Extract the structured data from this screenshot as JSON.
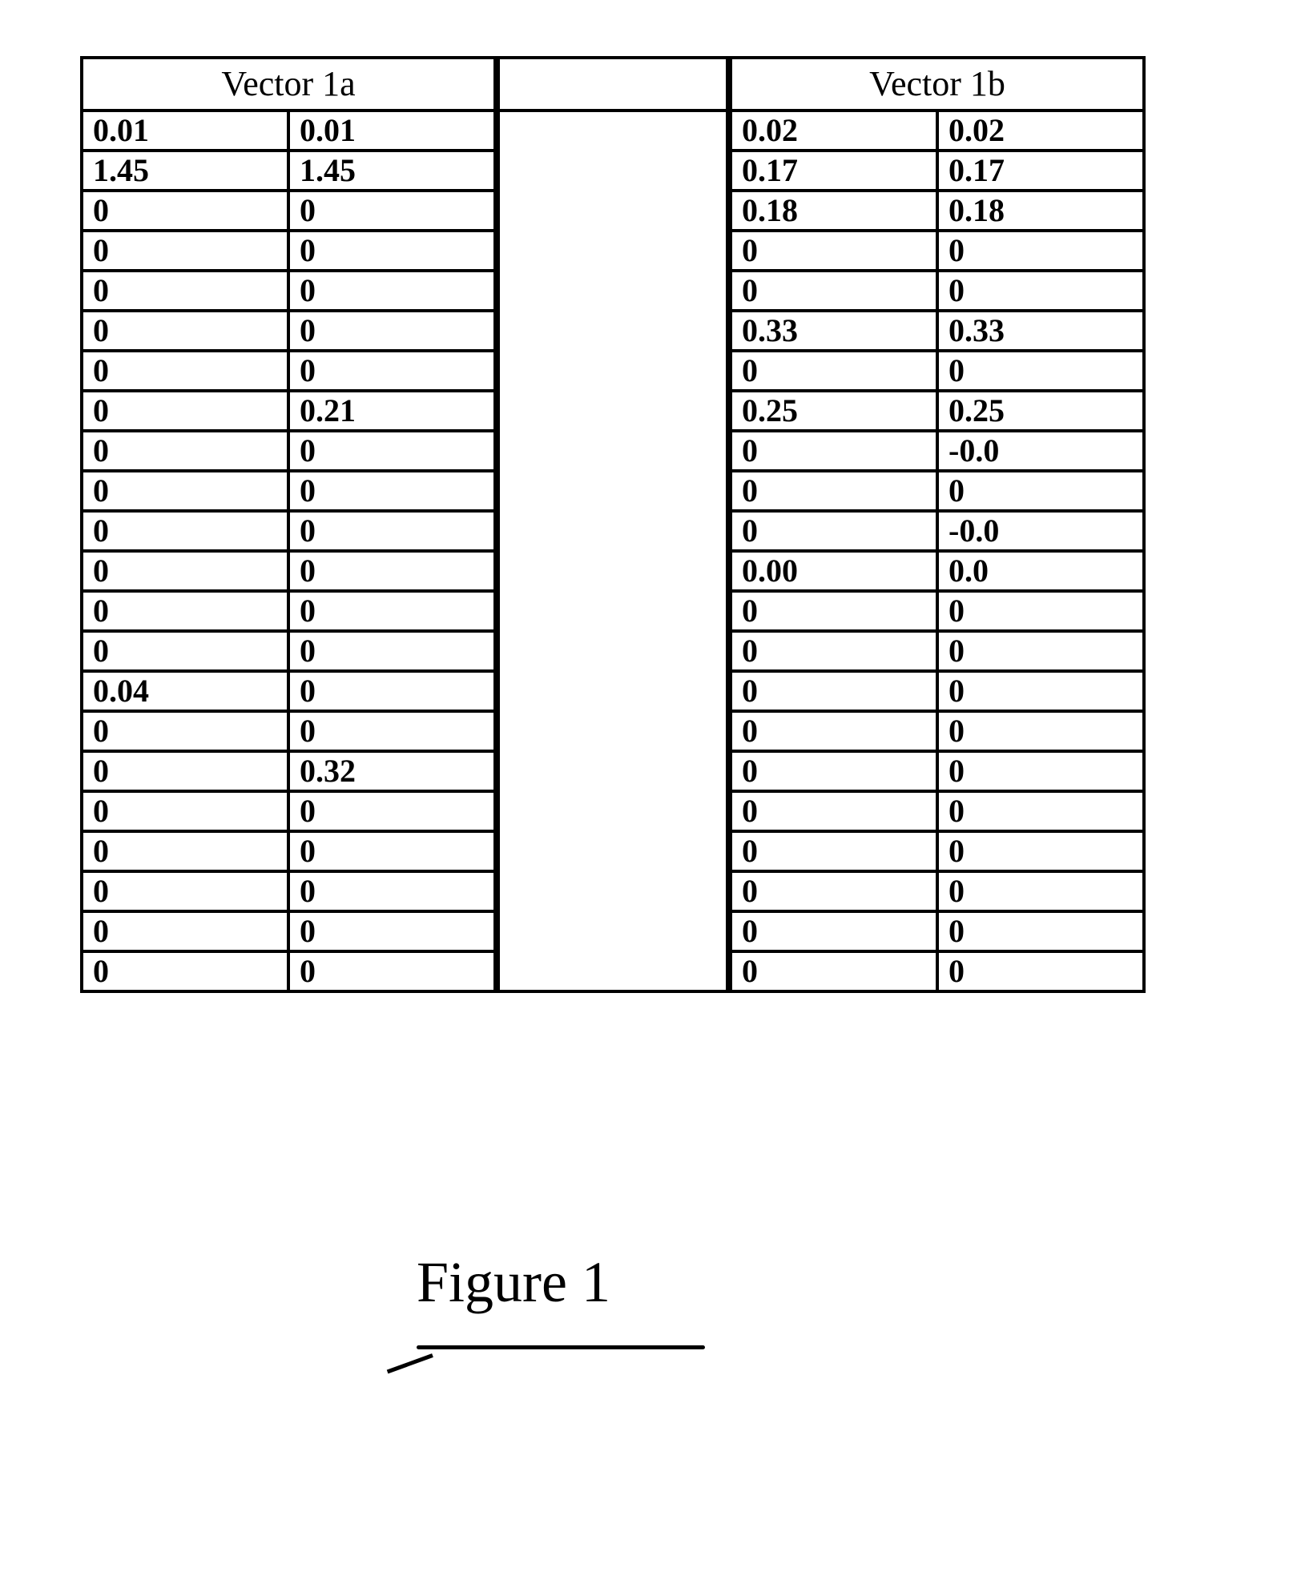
{
  "vector_a": {
    "title": "Vector 1a",
    "rows": [
      [
        "0.01",
        "0.01"
      ],
      [
        "1.45",
        "1.45"
      ],
      [
        "0",
        "0"
      ],
      [
        "0",
        "0"
      ],
      [
        "0",
        "0"
      ],
      [
        "0",
        "0"
      ],
      [
        "0",
        "0"
      ],
      [
        "0",
        "0.21"
      ],
      [
        "0",
        "0"
      ],
      [
        "0",
        "0"
      ],
      [
        "0",
        "0"
      ],
      [
        "0",
        "0"
      ],
      [
        "0",
        "0"
      ],
      [
        "0",
        "0"
      ],
      [
        "0.04",
        "0"
      ],
      [
        "0",
        "0"
      ],
      [
        "0",
        "0.32"
      ],
      [
        "0",
        "0"
      ],
      [
        "0",
        "0"
      ],
      [
        "0",
        "0"
      ],
      [
        "0",
        "0"
      ],
      [
        "0",
        "0"
      ]
    ]
  },
  "vector_b": {
    "title": "Vector 1b",
    "rows": [
      [
        "0.02",
        "0.02"
      ],
      [
        "0.17",
        "0.17"
      ],
      [
        "0.18",
        "0.18"
      ],
      [
        "0",
        "0"
      ],
      [
        "0",
        "0"
      ],
      [
        "0.33",
        "0.33"
      ],
      [
        "0",
        "0"
      ],
      [
        "0.25",
        "0.25"
      ],
      [
        "0",
        "-0.0"
      ],
      [
        "0",
        "0"
      ],
      [
        "0",
        "-0.0"
      ],
      [
        "0.00",
        "0.0"
      ],
      [
        "0",
        "0"
      ],
      [
        "0",
        "0"
      ],
      [
        "0",
        "0"
      ],
      [
        "0",
        "0"
      ],
      [
        "0",
        "0"
      ],
      [
        "0",
        "0"
      ],
      [
        "0",
        "0"
      ],
      [
        "0",
        "0"
      ],
      [
        "0",
        "0"
      ],
      [
        "0",
        "0"
      ]
    ]
  },
  "figure_label": "Figure 1"
}
